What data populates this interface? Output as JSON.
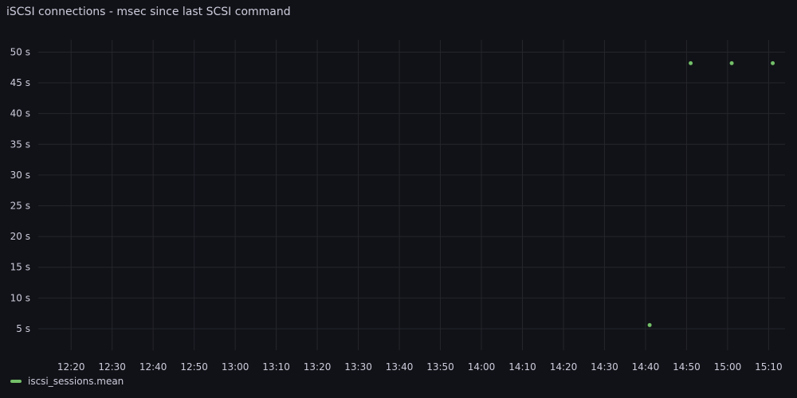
{
  "panel": {
    "title": "iSCSI connections - msec since last SCSI command"
  },
  "colors": {
    "background": "#111217",
    "grid": "#24262c",
    "text": "#ccccdc",
    "series": "#73bf69"
  },
  "chart_data": {
    "type": "scatter",
    "title": "iSCSI connections - msec since last SCSI command",
    "xlabel": "",
    "ylabel": "",
    "x_ticks": [
      "12:20",
      "12:30",
      "12:40",
      "12:50",
      "13:00",
      "13:10",
      "13:20",
      "13:30",
      "13:40",
      "13:50",
      "14:00",
      "14:10",
      "14:20",
      "14:30",
      "14:40",
      "14:50",
      "15:00",
      "15:10"
    ],
    "xlim": [
      "12:12",
      "15:14"
    ],
    "y_ticks": [
      "5 s",
      "10 s",
      "15 s",
      "20 s",
      "25 s",
      "30 s",
      "35 s",
      "40 s",
      "45 s",
      "50 s"
    ],
    "ylim": [
      1.5,
      52
    ],
    "y_unit": "s",
    "grid": true,
    "legend_position": "bottom-left",
    "series": [
      {
        "name": "iscsi_sessions.mean",
        "color": "#73bf69",
        "points": [
          {
            "x": "14:41",
            "y": 5.6
          },
          {
            "x": "14:51",
            "y": 48.2
          },
          {
            "x": "15:01",
            "y": 48.2
          },
          {
            "x": "15:11",
            "y": 48.2
          }
        ]
      }
    ]
  }
}
